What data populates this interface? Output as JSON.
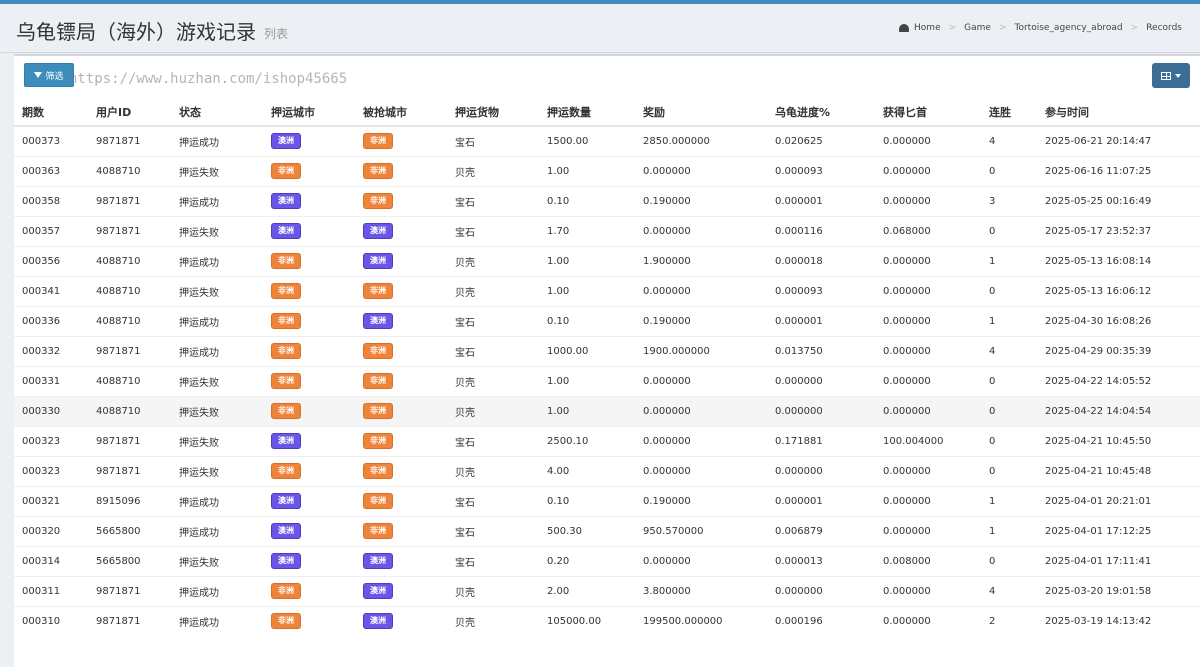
{
  "header": {
    "title": "乌龟镖局（海外）游戏记录",
    "subtitle": "列表",
    "breadcrumb": [
      "Home",
      "Game",
      "Tortoise_agency_abroad",
      "Records"
    ]
  },
  "toolbar": {
    "filter_label": "筛选",
    "watermark": "https://www.huzhan.com/ishop45665",
    "columns_icon": "grid-icon"
  },
  "colors": {
    "tag_blue": "#6a55e6",
    "tag_orange": "#f0833a",
    "primary": "#3c8dbc"
  },
  "table": {
    "columns": [
      "期数",
      "用户ID",
      "状态",
      "押运城市",
      "被抢城市",
      "押运货物",
      "押运数量",
      "奖励",
      "乌龟进度%",
      "获得匕首",
      "连胜",
      "参与时间"
    ],
    "rows": [
      [
        "000373",
        "9871871",
        "押运成功",
        "澳洲",
        "非洲",
        "宝石",
        "1500.00",
        "2850.000000",
        "0.020625",
        "0.000000",
        "4",
        "2025-06-21 20:14:47"
      ],
      [
        "000363",
        "4088710",
        "押运失败",
        "非洲",
        "非洲",
        "贝壳",
        "1.00",
        "0.000000",
        "0.000093",
        "0.000000",
        "0",
        "2025-06-16 11:07:25"
      ],
      [
        "000358",
        "9871871",
        "押运成功",
        "澳洲",
        "非洲",
        "宝石",
        "0.10",
        "0.190000",
        "0.000001",
        "0.000000",
        "3",
        "2025-05-25 00:16:49"
      ],
      [
        "000357",
        "9871871",
        "押运失败",
        "澳洲",
        "澳洲",
        "宝石",
        "1.70",
        "0.000000",
        "0.000116",
        "0.068000",
        "0",
        "2025-05-17 23:52:37"
      ],
      [
        "000356",
        "4088710",
        "押运成功",
        "非洲",
        "澳洲",
        "贝壳",
        "1.00",
        "1.900000",
        "0.000018",
        "0.000000",
        "1",
        "2025-05-13 16:08:14"
      ],
      [
        "000341",
        "4088710",
        "押运失败",
        "非洲",
        "非洲",
        "贝壳",
        "1.00",
        "0.000000",
        "0.000093",
        "0.000000",
        "0",
        "2025-05-13 16:06:12"
      ],
      [
        "000336",
        "4088710",
        "押运成功",
        "非洲",
        "澳洲",
        "宝石",
        "0.10",
        "0.190000",
        "0.000001",
        "0.000000",
        "1",
        "2025-04-30 16:08:26"
      ],
      [
        "000332",
        "9871871",
        "押运成功",
        "非洲",
        "非洲",
        "宝石",
        "1000.00",
        "1900.000000",
        "0.013750",
        "0.000000",
        "4",
        "2025-04-29 00:35:39"
      ],
      [
        "000331",
        "4088710",
        "押运失败",
        "非洲",
        "非洲",
        "贝壳",
        "1.00",
        "0.000000",
        "0.000000",
        "0.000000",
        "0",
        "2025-04-22 14:05:52"
      ],
      [
        "000330",
        "4088710",
        "押运失败",
        "非洲",
        "非洲",
        "贝壳",
        "1.00",
        "0.000000",
        "0.000000",
        "0.000000",
        "0",
        "2025-04-22 14:04:54"
      ],
      [
        "000323",
        "9871871",
        "押运失败",
        "澳洲",
        "非洲",
        "宝石",
        "2500.10",
        "0.000000",
        "0.171881",
        "100.004000",
        "0",
        "2025-04-21 10:45:50"
      ],
      [
        "000323",
        "9871871",
        "押运失败",
        "非洲",
        "非洲",
        "贝壳",
        "4.00",
        "0.000000",
        "0.000000",
        "0.000000",
        "0",
        "2025-04-21 10:45:48"
      ],
      [
        "000321",
        "8915096",
        "押运成功",
        "澳洲",
        "非洲",
        "宝石",
        "0.10",
        "0.190000",
        "0.000001",
        "0.000000",
        "1",
        "2025-04-01 20:21:01"
      ],
      [
        "000320",
        "5665800",
        "押运成功",
        "澳洲",
        "非洲",
        "宝石",
        "500.30",
        "950.570000",
        "0.006879",
        "0.000000",
        "1",
        "2025-04-01 17:12:25"
      ],
      [
        "000314",
        "5665800",
        "押运失败",
        "澳洲",
        "澳洲",
        "宝石",
        "0.20",
        "0.000000",
        "0.000013",
        "0.008000",
        "0",
        "2025-04-01 17:11:41"
      ],
      [
        "000311",
        "9871871",
        "押运成功",
        "非洲",
        "澳洲",
        "贝壳",
        "2.00",
        "3.800000",
        "0.000000",
        "0.000000",
        "4",
        "2025-03-20 19:01:58"
      ],
      [
        "000310",
        "9871871",
        "押运成功",
        "非洲",
        "澳洲",
        "贝壳",
        "105000.00",
        "199500.000000",
        "0.000196",
        "0.000000",
        "2",
        "2025-03-19 14:13:42"
      ]
    ]
  }
}
